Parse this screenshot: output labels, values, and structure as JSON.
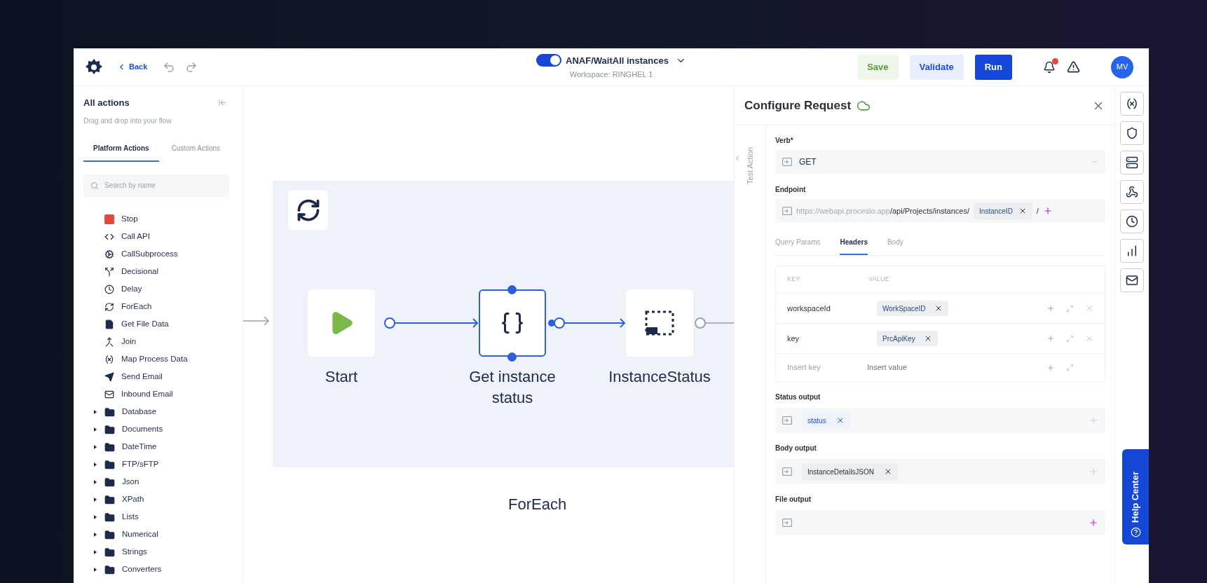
{
  "header": {
    "back": "Back",
    "flow_enabled": true,
    "flow_title": "ANAF/WaitAll instances",
    "workspace": "Workspace: RINGHEL 1",
    "buttons": [
      {
        "label": "Save",
        "kind": "save"
      },
      {
        "label": "Validate",
        "kind": "validate"
      },
      {
        "label": "Run",
        "kind": "run"
      }
    ],
    "avatar": "MV"
  },
  "sidebar": {
    "title": "All actions",
    "subtitle": "Drag and drop into your flow",
    "tabs": [
      {
        "label": "Platform Actions",
        "selected": true
      },
      {
        "label": "Custom Actions",
        "selected": false
      }
    ],
    "search": {
      "placeholder": "Search by name"
    },
    "actions": [
      {
        "label": "Stop",
        "kind": "stop"
      },
      {
        "label": "Call API",
        "kind": "api"
      },
      {
        "label": "CallSubprocess",
        "kind": "subprocess"
      },
      {
        "label": "Decisional",
        "kind": "decision"
      },
      {
        "label": "Delay",
        "kind": "delay"
      },
      {
        "label": "ForEach",
        "kind": "loop"
      },
      {
        "label": "Get File Data",
        "kind": "file"
      },
      {
        "label": "Join",
        "kind": "join"
      },
      {
        "label": "Map Process Data",
        "kind": "mapping"
      },
      {
        "label": "Send Email",
        "kind": "send"
      },
      {
        "label": "Inbound Email",
        "kind": "inbound"
      }
    ],
    "folders": [
      {
        "label": "Database",
        "expanded": false
      },
      {
        "label": "Documents",
        "expanded": false
      },
      {
        "label": "DateTime",
        "expanded": false
      },
      {
        "label": "FTP/sFTP",
        "expanded": false
      },
      {
        "label": "Json",
        "expanded": false
      },
      {
        "label": "XPath",
        "expanded": false
      },
      {
        "label": "Lists",
        "expanded": false
      },
      {
        "label": "Numerical",
        "expanded": false
      },
      {
        "label": "Strings",
        "expanded": false
      },
      {
        "label": "Converters",
        "expanded": false
      }
    ]
  },
  "canvas": {
    "container": "ForEach",
    "nodes": [
      {
        "label": "Start",
        "kind": "start",
        "selected": false
      },
      {
        "label": "Get instance status",
        "kind": "transform",
        "selected": true
      },
      {
        "label": "InstanceStatus",
        "kind": "status",
        "selected": false
      }
    ]
  },
  "config": {
    "title": "Configure Request",
    "side_tab": "Test Action",
    "verb": {
      "label": "Verb*",
      "value": "GET"
    },
    "endpoint": {
      "label": "Endpoint",
      "base": "https://webapi.procesio.app",
      "path": "/api/Projects/instances/",
      "token": "InstanceID",
      "suffix": "/"
    },
    "tabs": [
      {
        "label": "Query Params",
        "selected": false
      },
      {
        "label": "Headers",
        "selected": true
      },
      {
        "label": "Body",
        "selected": false
      }
    ],
    "headers_table": {
      "columns": [
        "KEY",
        "VALUE"
      ],
      "rows": [
        {
          "key": "workspaceId",
          "value": "WorkSpaceID"
        },
        {
          "key": "key",
          "value": "PrcApiKey"
        }
      ],
      "new_row": {
        "key_placeholder": "Insert key",
        "value_placeholder": "Insert value"
      }
    },
    "outputs": [
      {
        "label": "Status output",
        "token": "status",
        "kind": "highlight"
      },
      {
        "label": "Body output",
        "token": "InstanceDetailsJSON",
        "kind": "plain"
      },
      {
        "label": "File output"
      }
    ]
  },
  "help": "Help Center"
}
